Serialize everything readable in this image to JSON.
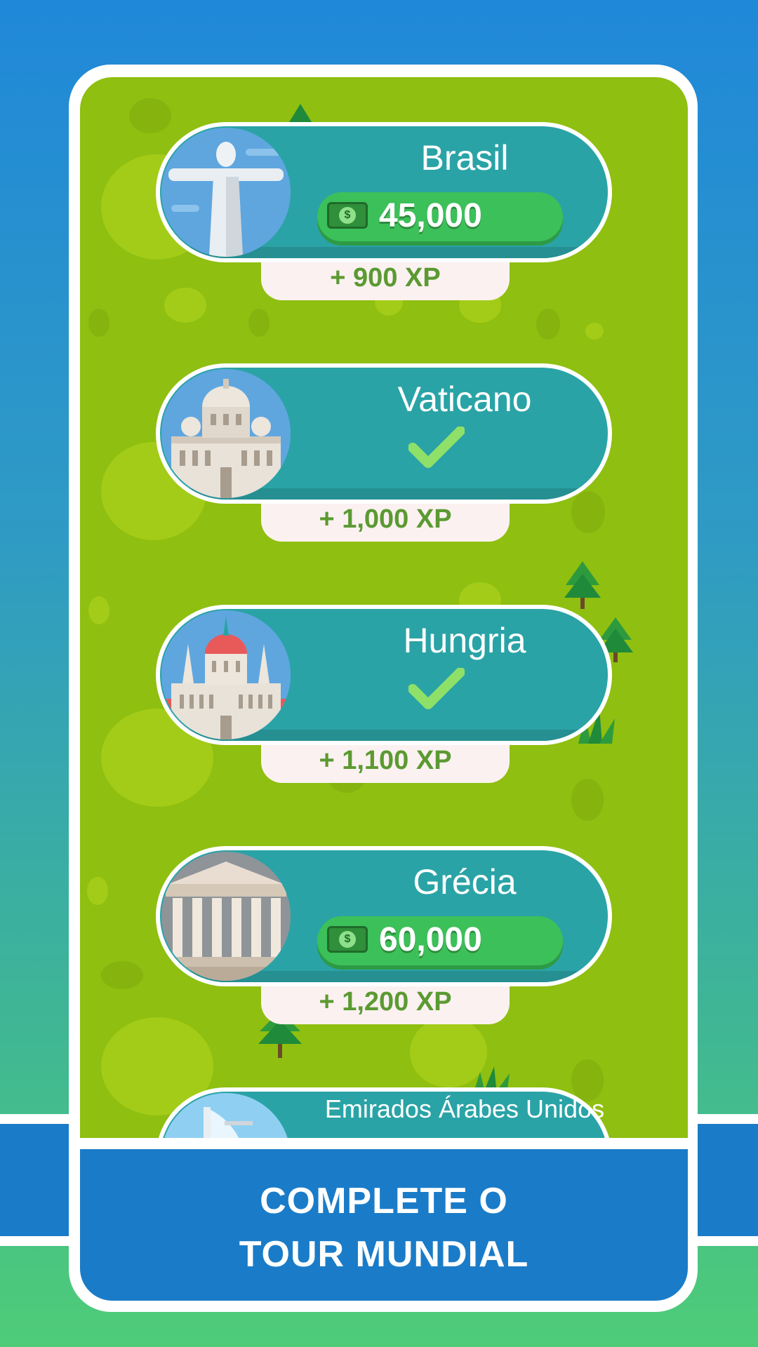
{
  "destinations": [
    {
      "country": "Brasil",
      "price": "45,000",
      "xp": "+ 900 XP",
      "status": "locked"
    },
    {
      "country": "Vaticano",
      "xp": "+ 1,000 XP",
      "status": "completed"
    },
    {
      "country": "Hungria",
      "xp": "+ 1,100 XP",
      "status": "completed"
    },
    {
      "country": "Grécia",
      "price": "60,000",
      "xp": "+ 1,200 XP",
      "status": "locked"
    },
    {
      "country": "Emirados Árabes Unidos",
      "status": "partial"
    }
  ],
  "banner": {
    "line1": "COMPLETE O",
    "line2": "TOUR MUNDIAL"
  },
  "icons": {
    "money": "money-bill-icon",
    "check": "checkmark-icon"
  },
  "colors": {
    "background_top": "#2088d8",
    "field": "#8fbf10",
    "card": "#2aa3a6",
    "price_pill": "#3cc05a",
    "banner": "#1a7cc8"
  }
}
